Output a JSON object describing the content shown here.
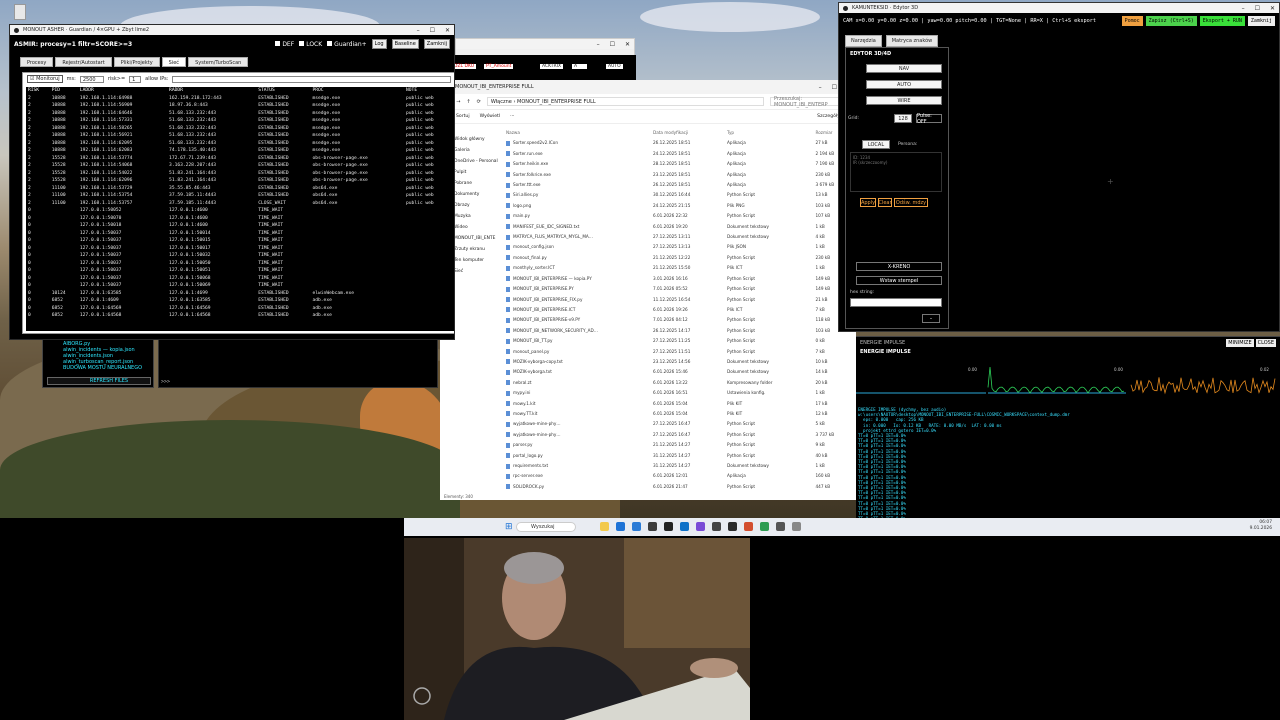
{
  "monitor": {
    "title": "MONOUT ASHER · Guardian / 4×GPU + Zbyt lime2",
    "header": "ASMIR: procesy=1 filtr=SCORE>=3",
    "opts": [
      "DEF",
      "LOCK",
      "Guardian+"
    ],
    "buttons": [
      "Log",
      "Baseline",
      "Zamknij"
    ],
    "tabs": [
      "Procesy",
      "Rejestr/Autostart",
      "Pliki/Projekty",
      "Sieć",
      "System/TurboScan"
    ],
    "filter": {
      "monitor_label": "Monitoruj",
      "ms_label": "ms:",
      "ms_value": "2500",
      "risk_label": "risk>=",
      "risk_value": "1",
      "allow_label": "allow IPs:"
    },
    "columns": [
      "RISK",
      "PID",
      "LADDR",
      "RADDR",
      "STATUS",
      "PROC",
      "NOTE"
    ],
    "rows": [
      [
        "2",
        "10888",
        "192.168.1.114:64988",
        "162.159.218.172:443",
        "ESTABLISHED",
        "msedge.exe",
        "public web"
      ],
      [
        "2",
        "10888",
        "192.168.1.114:56909",
        "18.97.36.8:443",
        "ESTABLISHED",
        "msedge.exe",
        "public web"
      ],
      [
        "2",
        "10888",
        "192.168.1.114:64646",
        "51.68.133.232:443",
        "ESTABLISHED",
        "msedge.exe",
        "public web"
      ],
      [
        "2",
        "10888",
        "192.168.1.114:57331",
        "51.68.133.232:443",
        "ESTABLISHED",
        "msedge.exe",
        "public web"
      ],
      [
        "2",
        "10888",
        "192.168.1.114:58265",
        "51.68.133.232:443",
        "ESTABLISHED",
        "msedge.exe",
        "public web"
      ],
      [
        "2",
        "10888",
        "192.168.1.114:56921",
        "51.68.133.232:443",
        "ESTABLISHED",
        "msedge.exe",
        "public web"
      ],
      [
        "2",
        "10888",
        "192.168.1.114:62095",
        "51.68.133.232:443",
        "ESTABLISHED",
        "msedge.exe",
        "public web"
      ],
      [
        "2",
        "10888",
        "192.168.1.114:62083",
        "74.178.135.40:443",
        "ESTABLISHED",
        "msedge.exe",
        "public web"
      ],
      [
        "2",
        "15528",
        "192.168.1.114:53774",
        "172.67.71.239:443",
        "ESTABLISHED",
        "obs-browser-page.exe",
        "public web"
      ],
      [
        "2",
        "15528",
        "192.168.1.114:54068",
        "3.163.228.207:443",
        "ESTABLISHED",
        "obs-browser-page.exe",
        "public web"
      ],
      [
        "2",
        "15528",
        "192.168.1.114:54022",
        "51.83.241.164:443",
        "ESTABLISHED",
        "obs-browser-page.exe",
        "public web"
      ],
      [
        "2",
        "15528",
        "192.168.1.114:62096",
        "51.83.241.164:443",
        "ESTABLISHED",
        "obs-browser-page.exe",
        "public web"
      ],
      [
        "2",
        "11100",
        "192.168.1.114:53729",
        "35.55.85.46:443",
        "ESTABLISHED",
        "obs64.exe",
        "public web"
      ],
      [
        "2",
        "11100",
        "192.168.1.114:53754",
        "37.59.185.11:4443",
        "ESTABLISHED",
        "obs64.exe",
        "public web"
      ],
      [
        "2",
        "11100",
        "192.168.1.114:53757",
        "37.59.185.11:4443",
        "CLOSE_WAIT",
        "obs64.exe",
        "public web"
      ],
      [
        "0",
        "",
        "127.0.0.1:50052",
        "127.0.0.1:4600",
        "TIME_WAIT",
        "",
        ""
      ],
      [
        "0",
        "",
        "127.0.0.1:50070",
        "127.0.0.1:4600",
        "TIME_WAIT",
        "",
        ""
      ],
      [
        "0",
        "",
        "127.0.0.1:50018",
        "127.0.0.1:4600",
        "TIME_WAIT",
        "",
        ""
      ],
      [
        "0",
        "",
        "127.0.0.1:50037",
        "127.0.0.1:50014",
        "TIME_WAIT",
        "",
        ""
      ],
      [
        "0",
        "",
        "127.0.0.1:50037",
        "127.0.0.1:50015",
        "TIME_WAIT",
        "",
        ""
      ],
      [
        "0",
        "",
        "127.0.0.1:50037",
        "127.0.0.1:50017",
        "TIME_WAIT",
        "",
        ""
      ],
      [
        "0",
        "",
        "127.0.0.1:50037",
        "127.0.0.1:50032",
        "TIME_WAIT",
        "",
        ""
      ],
      [
        "0",
        "",
        "127.0.0.1:50037",
        "127.0.0.1:50050",
        "TIME_WAIT",
        "",
        ""
      ],
      [
        "0",
        "",
        "127.0.0.1:50037",
        "127.0.0.1:50051",
        "TIME_WAIT",
        "",
        ""
      ],
      [
        "0",
        "",
        "127.0.0.1:50037",
        "127.0.0.1:50068",
        "TIME_WAIT",
        "",
        ""
      ],
      [
        "0",
        "",
        "127.0.0.1:50037",
        "127.0.0.1:50069",
        "TIME_WAIT",
        "",
        ""
      ],
      [
        "0",
        "10124",
        "127.0.0.1:63585",
        "127.0.0.1:4699",
        "ESTABLISHED",
        "elwinWebcam.exe",
        ""
      ],
      [
        "0",
        "6852",
        "127.0.0.1:4609",
        "127.0.0.1:63585",
        "ESTABLISHED",
        "adb.exe",
        ""
      ],
      [
        "0",
        "6852",
        "127.0.0.1:64569",
        "127.0.0.1:64569",
        "ESTABLISHED",
        "adb.exe",
        ""
      ],
      [
        "0",
        "6852",
        "127.0.0.1:64568",
        "127.0.0.1:64568",
        "ESTABLISHED",
        "adb.exe",
        ""
      ]
    ]
  },
  "explorer": {
    "title": "MONOUT_IBI_ENTERPRISE FULL",
    "address": "Włączne  ›  MONOUT_IBI_ENTERPRISE FULL",
    "search": "Przeszukaj: MONOUT_IBI_ENTERP",
    "tools": [
      "Sortuj",
      "Wyświetl",
      "···",
      "Szczegóły"
    ],
    "sidebar": [
      "Widok główny",
      "Galeria",
      "OneDrive - Personal",
      "Pulpit",
      "Pobrane",
      "Dokumenty",
      "Obrazy",
      "Muzyka",
      "Wideo",
      "MONOUT_IBI_ENTE",
      "Zrzuty ekranu",
      "Ten komputer",
      "Sieć"
    ],
    "columns": [
      "Nazwa",
      "Data modyfikacji",
      "Typ",
      "Rozmiar"
    ],
    "files": [
      [
        "Sorter.speed2v2.ICon",
        "26.12.2025 18:51",
        "Aplikacja",
        "27 kB"
      ],
      [
        "Sorter.run.exe",
        "24.12.2025 18:51",
        "Aplikacja",
        "2 194 kB"
      ],
      [
        "Sorter.heikin.exe",
        "28.12.2025 18:51",
        "Aplikacja",
        "7 190 kB"
      ],
      [
        "Sorter.folkrice.exe",
        "23.12.2025 18:51",
        "Aplikacja",
        "230 kB"
      ],
      [
        "Sorter.ttt.exe",
        "26.12.2025 18:51",
        "Aplikacja",
        "3 679 kB"
      ],
      [
        "Siri.allies.py",
        "30.12.2025 16:44",
        "Python Script",
        "13 kB"
      ],
      [
        "logo.png",
        "24.12.2025 21:15",
        "Plik PNG",
        "103 kB"
      ],
      [
        "main.py",
        "6.01.2026 22:32",
        "Python Script",
        "107 kB"
      ],
      [
        "MANIFEST_EUE_IDC_SIGNED.txt",
        "6.01.2026 19:20",
        "Dokument tekstowy",
        "1 kB"
      ],
      [
        "MATRYCA_FLUS_MATRYCA_MYGL_MA…",
        "27.12.2025 13:11",
        "Dokument tekstowy",
        "4 kB"
      ],
      [
        "monout_config.json",
        "27.12.2025 13:13",
        "Plik JSON",
        "1 kB"
      ],
      [
        "monout_final.py",
        "21.12.2025 12:22",
        "Python Script",
        "230 kB"
      ],
      [
        "monthyly_sorter.ICT",
        "21.12.2025 15:50",
        "Plik ICT",
        "1 kB"
      ],
      [
        "MONOUT_IBI_ENTERPRISE — kopia.PY",
        "3.01.2026 16:16",
        "Python Script",
        "149 kB"
      ],
      [
        "MONOUT_IBI_ENTERPRISE.PY",
        "7.01.2026 05:52",
        "Python Script",
        "149 kB"
      ],
      [
        "MONOUT_IBI_ENTERPRISE_FIX.py",
        "11.12.2025 16:54",
        "Python Script",
        "21 kB"
      ],
      [
        "MONOUT_IBI_ENTERPRISE.ICT",
        "6.01.2026 19:26",
        "Plik ICT",
        "7 kB"
      ],
      [
        "MONOUT_IBI_ENTERPRISE-v9.PY",
        "7.01.2026 04:12",
        "Python Script",
        "118 kB"
      ],
      [
        "MONOUT_IBI_NETWORK_SECURITY_AD…",
        "26.12.2025 14:17",
        "Python Script",
        "103 kB"
      ],
      [
        "MONOUT_IBI_TT.py",
        "27.12.2025 11:25",
        "Python Script",
        "0 kB"
      ],
      [
        "monout_panel.py",
        "27.12.2025 11:51",
        "Python Script",
        "7 kB"
      ],
      [
        "MOZIK-vyborga-copy.txt",
        "23.12.2025 14:56",
        "Dokument tekstowy",
        "10 kB"
      ],
      [
        "MOZIK-vyborga.txt",
        "6.01.2026 15:46",
        "Dokument tekstowy",
        "14 kB"
      ],
      [
        "nebral.zt",
        "6.01.2026 13:22",
        "Kompresowany folder",
        "20 kB"
      ],
      [
        "mypy.ini",
        "6.01.2026 16:51",
        "Ustawienia konfig.",
        "1 kB"
      ],
      [
        "mowy.1.kit",
        "6.01.2026 15:04",
        "Plik KIT",
        "17 kB"
      ],
      [
        "mowy.TT.kit",
        "6.01.2026 15:04",
        "Plik KIT",
        "12 kB"
      ],
      [
        "wyjatkowe-mine-phy…",
        "27.12.2025 16:47",
        "Python Script",
        "5 kB"
      ],
      [
        "wyjatkowe-mine-phy…",
        "27.12.2025 16:47",
        "Python Script",
        "3 737 kB"
      ],
      [
        "parser.py",
        "21.12.2025 14:27",
        "Python Script",
        "9 kB"
      ],
      [
        "portal_logo.py",
        "31.12.2025 14:27",
        "Python Script",
        "40 kB"
      ],
      [
        "requirements.txt",
        "31.12.2025 14:27",
        "Dokument tekstowy",
        "1 kB"
      ],
      [
        "rpc-server.exe",
        "6.01.2026 12:01",
        "Aplikacja",
        "160 kB"
      ],
      [
        "SOLIDROCK.py",
        "6.01.2026 21:47",
        "Python Script",
        "447 kB"
      ]
    ],
    "status": "Elementy: 340"
  },
  "smallwin": {
    "title": "",
    "labels": [
      "DZL DKU",
      "PT_Amount",
      "ACKTRIX",
      "A",
      "AUTO"
    ]
  },
  "editor": {
    "title": "KAMUNTEKSID · Edytor 3D",
    "status": "CAM x=0.00 y=0.00 z=0.00 | yaw=0.00 pitch=0.00 | TGT=None | RR=X | Ctrl+S eksport",
    "buttons": [
      "Pomoc",
      "Zapisz (Ctrl+S)",
      "Eksport + RUN",
      "Zamknij"
    ],
    "button_colors": [
      "#f0a040",
      "#4cd24c",
      "#39e039",
      "#eeeeee"
    ],
    "tabs": [
      "Narzędzia",
      "Matryca znaków"
    ],
    "heading": "EDYTOR 3D/4D",
    "side_buttons": [
      "NAV",
      "AUTO",
      "WIRE"
    ],
    "fields": {
      "sm_label": "Grid:",
      "sm_value": "128",
      "pulse": "Pulse: OFF",
      "persona_label": "Persona:",
      "persona_value": "LOCAL"
    },
    "actions": [
      "Apply",
      "Clear",
      "Odśw. mdzy"
    ],
    "mode": "X-KRENO",
    "stamp": "Wstaw stempel",
    "hex_label": "hex string:",
    "log": [
      "ID: 1234",
      "IR (skrzeczoomy)"
    ]
  },
  "impulse": {
    "title": "ENERGIE IMPULSE",
    "subtitle": "ENERGIE IMPULSE",
    "buttons": [
      "MINIMIZE",
      "CLOSE"
    ],
    "scales": [
      "0.00",
      "0.00",
      "0.02"
    ],
    "log_lines": [
      "ENERGIE IMPULSE (dychmy, bez audio)",
      "w:\\users\\NAUTOR\\desktop\\MONOUT_IBI_ENTERPRISE-FULL\\COSMIC_WORKSPACE\\context_dump.dmr",
      "  eps: 0.000   cap: 256 KB",
      "  in: 0.000   Io: 0.12 KB   RATE: 0.00 MB/s  LAT: 0.00 ms",
      "  projekt ettrd gotero IET=0.0%",
      "",
      "TT=0 pTT=1 IET=0.0%",
      "TT=0 pTT=1 IET=0.0%",
      "TT=0 pTT=1 IET=0.0%",
      "TT=0 pTT=1 IET=0.0%",
      "TT=0 pTT=1 IET=0.0%",
      "TT=0 pTT=1 IET=0.0%",
      "TT=0 pTT=1 IET=0.0%",
      "TT=0 pTT=1 IET=0.0%",
      "TT=0 pTT=1 IET=0.0%",
      "TT=0 pTT=1 IET=0.0%",
      "TT=0 pTT=1 IET=0.0%",
      "TT=0 pTT=1 IET=0.0%",
      "TT=0 pTT=1 IET=0.0%",
      "TT=0 pTT=1 IET=0.0%",
      "TT=0 pTT=1 IET=0.0%",
      "TT=0 pTT=1 IET=0.0%",
      "TT=0 pTT=1 IET=0.0%",
      "TT=0 pTT=1 IET=0.0%",
      "TT=0 pTT=1 IET=0.0%"
    ]
  },
  "darkfiles": {
    "items": [
      "AIBORG.py",
      "alwin_incidents — kopia.json",
      "alwin_incidents.json",
      "alwin_turboscan_report.json",
      "BUDOWA MOSTU NEURALNEGO"
    ],
    "refresh": "REFRESH FILES",
    "term_prompt": ">>>"
  },
  "taskbar": {
    "search_placeholder": "Wyszukaj",
    "time": "06:07",
    "date": "9.01.2026"
  }
}
